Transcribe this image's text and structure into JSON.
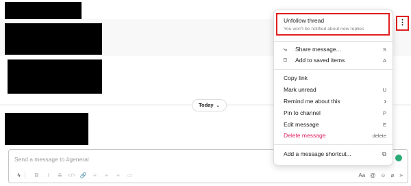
{
  "message_menu": {
    "unfollow_title": "Unfollow thread",
    "unfollow_subtitle": "You won't be notified about new replies",
    "items_group1": [
      {
        "icon": "share-icon",
        "glyph": "⤷",
        "label": "Share message...",
        "shortcut": "S"
      },
      {
        "icon": "bookmark-icon",
        "glyph": "⌑",
        "label": "Add to saved items",
        "shortcut": "A"
      }
    ],
    "items_group2": [
      {
        "label": "Copy link",
        "shortcut": ""
      },
      {
        "label": "Mark unread",
        "shortcut": "U"
      },
      {
        "label": "Remind me about this",
        "shortcut": "›"
      },
      {
        "label": "Pin to channel",
        "shortcut": "P"
      },
      {
        "label": "Edit message",
        "shortcut": "E"
      },
      {
        "label": "Delete message",
        "shortcut": "delete",
        "danger": true
      }
    ],
    "footer_item": {
      "label": "Add a message shortcut...",
      "icon": "external-link-icon",
      "glyph": "⧉"
    },
    "danger_color": "#e01e5a",
    "highlight_color": "#e01e1e"
  },
  "kebab": {
    "glyph": "⋮"
  },
  "date_divider": {
    "label": "Today",
    "chevron": "⌄"
  },
  "composer": {
    "placeholder": "Send a message to #general",
    "format_tools": [
      "B",
      "I",
      "S",
      "</>",
      "🔗",
      "≡",
      "≡",
      "≡",
      "▭"
    ],
    "right_tools": [
      "Aa",
      "@",
      "☺",
      "⌀",
      "➤"
    ]
  }
}
